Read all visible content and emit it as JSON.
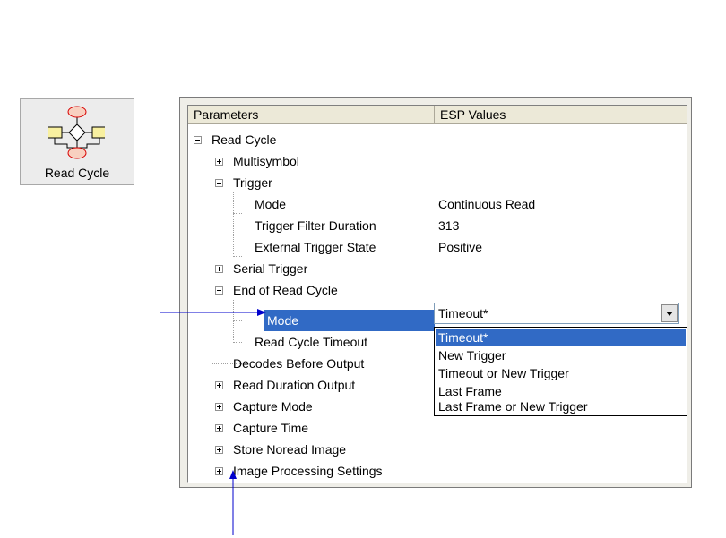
{
  "icon_tile": {
    "label": "Read Cycle",
    "icon": "flowchart-icon"
  },
  "table": {
    "col_parameters": "Parameters",
    "col_values": "ESP Values"
  },
  "tree": {
    "root": "Read Cycle",
    "multisymbol": "Multisymbol",
    "trigger": "Trigger",
    "trigger_mode": "Mode",
    "trigger_mode_value": "Continuous Read",
    "trigger_filter": "Trigger Filter Duration",
    "trigger_filter_value": "313",
    "external_trigger": "External Trigger State",
    "external_trigger_value": "Positive",
    "serial_trigger": "Serial Trigger",
    "end_of_read_cycle": "End of Read Cycle",
    "eorc_mode": "Mode",
    "read_cycle_timeout": "Read Cycle Timeout",
    "decodes_before_output": "Decodes Before Output",
    "read_duration_output": "Read Duration Output",
    "capture_mode": "Capture Mode",
    "capture_time": "Capture Time",
    "store_noread_image": "Store Noread Image",
    "image_processing": "Image Processing Settings"
  },
  "combo": {
    "selected": "Timeout*",
    "options": [
      "Timeout*",
      "New Trigger",
      "Timeout or New Trigger",
      "Last Frame",
      "Last Frame or New Trigger"
    ]
  },
  "colors": {
    "selection": "#316ac5",
    "arrow": "#0000cc"
  }
}
